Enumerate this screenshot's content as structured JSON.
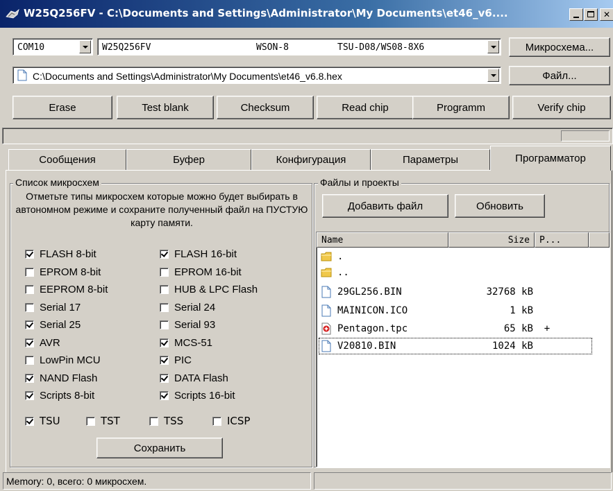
{
  "window": {
    "title": "W25Q256FV - C:\\Documents and Settings\\Administrator\\My Documents\\et46_v6....",
    "controls": [
      "minimize",
      "maximize",
      "close"
    ]
  },
  "chip_row": {
    "port": "COM10",
    "chip_name": "W25Q256FV",
    "package": "WSON-8",
    "adapter": "TSU-D08/WS08-8X6",
    "chip_button": "Микросхема..."
  },
  "file_row": {
    "path": "C:\\Documents and Settings\\Administrator\\My Documents\\et46_v6.8.hex",
    "file_button": "Файл..."
  },
  "actions": {
    "erase": "Erase",
    "test_blank": "Test blank",
    "checksum": "Checksum",
    "read_chip": "Read chip",
    "programm": "Programm",
    "verify_chip": "Verify chip"
  },
  "tabs": [
    {
      "label": "Сообщения",
      "active": false
    },
    {
      "label": "Буфер",
      "active": false
    },
    {
      "label": "Конфигурация",
      "active": false
    },
    {
      "label": "Параметры",
      "active": false
    },
    {
      "label": "Программатор",
      "active": true
    }
  ],
  "chip_list": {
    "title": "Список микросхем",
    "description": "Отметьте типы микросхем которые можно будет выбирать в автономном режиме и сохраните полученный файл на ПУСТУЮ карту памяти.",
    "types": [
      {
        "label": "FLASH 8-bit",
        "checked": true
      },
      {
        "label": "FLASH 16-bit",
        "checked": true
      },
      {
        "label": "EPROM 8-bit",
        "checked": false
      },
      {
        "label": "EPROM 16-bit",
        "checked": false
      },
      {
        "label": "EEPROM 8-bit",
        "checked": false
      },
      {
        "label": "HUB & LPC Flash",
        "checked": false
      },
      {
        "label": "Serial 17",
        "checked": false
      },
      {
        "label": "Serial 24",
        "checked": false
      },
      {
        "label": "Serial 25",
        "checked": true
      },
      {
        "label": "Serial 93",
        "checked": false
      },
      {
        "label": "AVR",
        "checked": true
      },
      {
        "label": "MCS-51",
        "checked": true
      },
      {
        "label": "LowPin MCU",
        "checked": false
      },
      {
        "label": "PIC",
        "checked": true
      },
      {
        "label": "NAND Flash",
        "checked": true
      },
      {
        "label": "DATA Flash",
        "checked": true
      },
      {
        "label": "Scripts 8-bit",
        "checked": true
      },
      {
        "label": "Scripts 16-bit",
        "checked": true
      }
    ],
    "interfaces": [
      {
        "label": "TSU",
        "checked": true
      },
      {
        "label": "TST",
        "checked": false
      },
      {
        "label": "TSS",
        "checked": false
      },
      {
        "label": "ICSP",
        "checked": false
      }
    ],
    "save_button": "Сохранить"
  },
  "files": {
    "title": "Файлы и проекты",
    "add_button": "Добавить файл",
    "refresh_button": "Обновить",
    "columns": [
      "Name",
      "Size",
      "P..."
    ],
    "rows": [
      {
        "icon": "folder-icon",
        "name": ".",
        "size": "",
        "p": ""
      },
      {
        "icon": "folder-icon",
        "name": "..",
        "size": "",
        "p": ""
      },
      {
        "icon": "file-icon",
        "name": "29GL256.BIN",
        "size": "32768 kB",
        "p": ""
      },
      {
        "icon": "file-icon",
        "name": "MAINICON.ICO",
        "size": "1 kB",
        "p": ""
      },
      {
        "icon": "project-file-icon",
        "name": "Pentagon.tpc",
        "size": "65 kB",
        "p": "+"
      },
      {
        "icon": "file-icon",
        "name": "V20810.BIN",
        "size": "1024 kB",
        "p": ""
      }
    ]
  },
  "status": {
    "memory": "Memory: 0,  всего: 0 микросхем."
  }
}
